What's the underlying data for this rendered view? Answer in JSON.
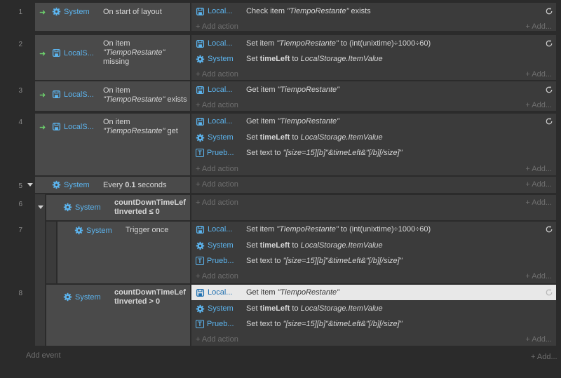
{
  "labels": {
    "add_action": "+ Add action",
    "add_right": "+ Add...",
    "add_event": "Add event",
    "add_event_right": "+ Add..."
  },
  "objects": {
    "system": "System",
    "local": "Local...",
    "locals": "LocalS...",
    "prueb": "Prueb..."
  },
  "events": [
    {
      "num": "1",
      "cond": "On start of layout",
      "actions": [
        "Check item \"TiempoRestante\" exists"
      ]
    },
    {
      "num": "2",
      "cond": [
        "On item",
        "\"TiempoRestante\"",
        "missing"
      ],
      "actions": [
        "Set item \"TiempoRestante\" to (int(unixtime)÷1000÷60)",
        "Set timeLeft to LocalStorage.ItemValue"
      ]
    },
    {
      "num": "3",
      "cond": [
        "On item",
        "\"TiempoRestante\" exists"
      ],
      "actions": [
        "Get item \"TiempoRestante\""
      ]
    },
    {
      "num": "4",
      "cond": [
        "On item",
        "\"TiempoRestante\" get"
      ],
      "actions": [
        "Get item \"TiempoRestante\"",
        "Set timeLeft to LocalStorage.ItemValue",
        "Set text to \"[size=15][b]\"&timeLeft&\"[/b][/size]\""
      ]
    },
    {
      "num": "5",
      "cond": "Every 0.1 seconds",
      "actions": []
    },
    {
      "num": "6",
      "cond": [
        "countDownTimeLef",
        "tInverted ≤ 0"
      ],
      "actions": []
    },
    {
      "num": "7",
      "cond": "Trigger once",
      "actions": [
        "Set item \"TiempoRestante\" to (int(unixtime)÷1000÷60)",
        "Set timeLeft to LocalStorage.ItemValue",
        "Set text to \"[size=15][b]\"&timeLeft&\"[/b][/size]\""
      ]
    },
    {
      "num": "8",
      "cond": [
        "countDownTimeLef",
        "tInverted > 0"
      ],
      "actions": [
        "Get item \"TiempoRestante\"",
        "Set timeLeft to LocalStorage.ItemValue",
        "Set text to \"[size=15][b]\"&timeLeft&\"[/b][/size]\""
      ]
    }
  ],
  "colors": {
    "accent": "#5cb4ee",
    "trigger_arrow": "#6dd36d",
    "highlight": "#e8e8e8"
  }
}
